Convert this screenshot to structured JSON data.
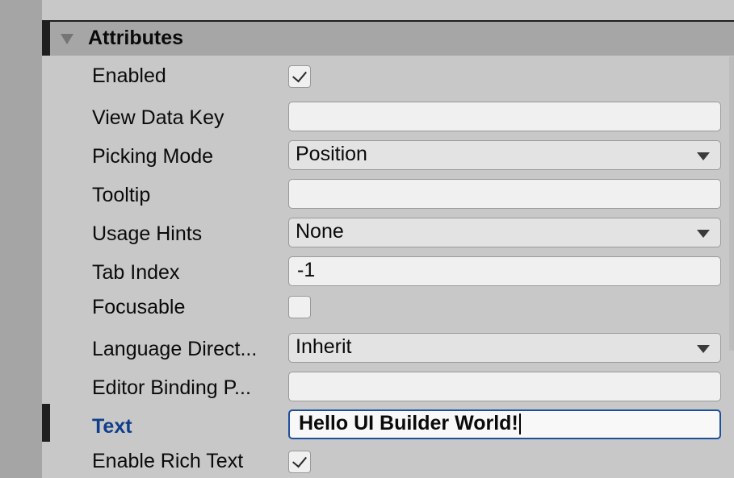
{
  "section": {
    "title": "Attributes",
    "expand_icon": "triangle-down-icon"
  },
  "rows": {
    "enabled": {
      "label": "Enabled",
      "checked": true
    },
    "view_data_key": {
      "label": "View Data Key",
      "value": ""
    },
    "picking_mode": {
      "label": "Picking Mode",
      "value": "Position"
    },
    "tooltip": {
      "label": "Tooltip",
      "value": ""
    },
    "usage_hints": {
      "label": "Usage Hints",
      "value": "None"
    },
    "tab_index": {
      "label": "Tab Index",
      "value": "-1"
    },
    "focusable": {
      "label": "Focusable",
      "checked": false
    },
    "language_direction": {
      "label": "Language Direct...",
      "value": "Inherit"
    },
    "editor_binding_path": {
      "label": "Editor Binding P...",
      "value": ""
    },
    "text": {
      "label": "Text",
      "value": "Hello UI Builder World!"
    },
    "enable_rich_text": {
      "label": "Enable Rich Text",
      "checked": true
    }
  },
  "colors": {
    "panel_bg": "#c8c8c8",
    "header_bg": "#a6a6a6",
    "focus_accent": "#1e4f9e",
    "label_highlight": "#103e8a"
  }
}
